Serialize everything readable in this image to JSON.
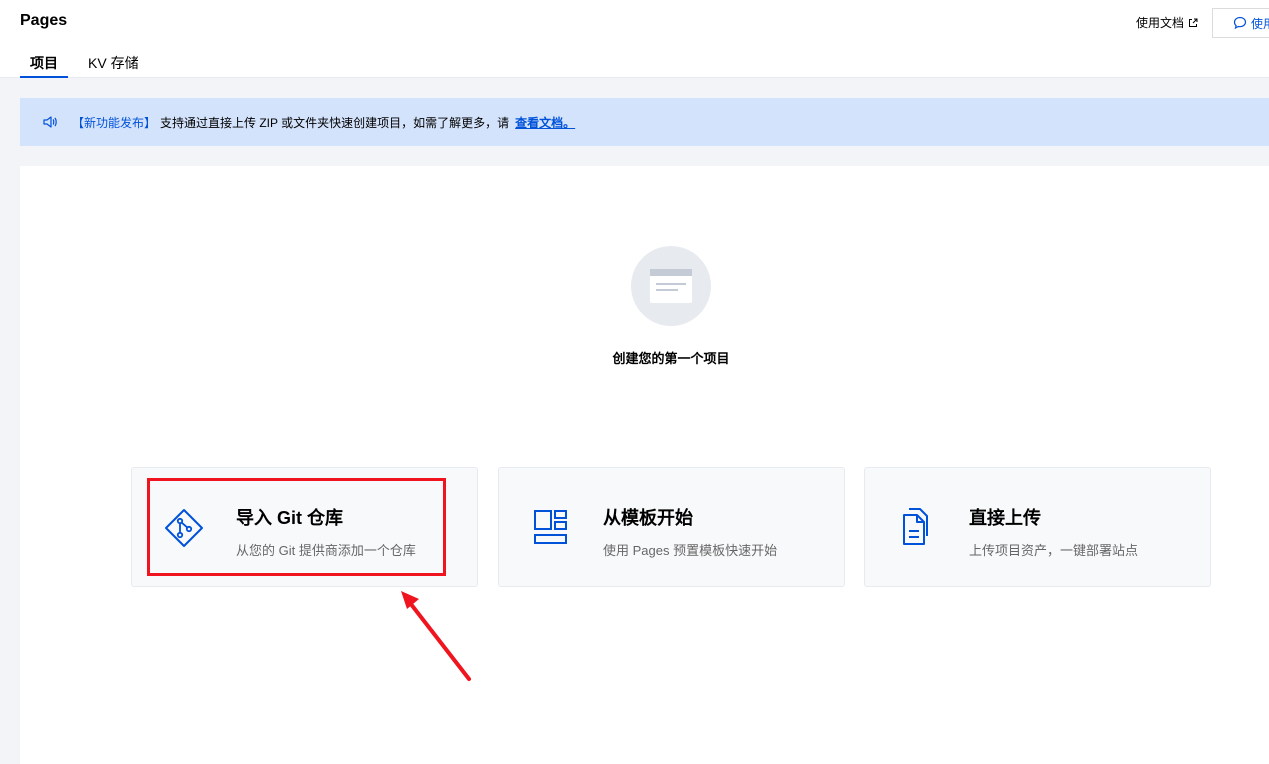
{
  "header": {
    "title": "Pages",
    "tabs": [
      {
        "label": "项目",
        "active": true
      },
      {
        "label": "KV 存储",
        "active": false
      }
    ],
    "doc_link": "使用文档",
    "feedback_button": "使用"
  },
  "notice": {
    "tag": "【新功能发布】",
    "text": "支持通过直接上传 ZIP 或文件夹快速创建项目，如需了解更多，请",
    "link": "查看文档。"
  },
  "empty_state": {
    "title": "创建您的第一个项目"
  },
  "cards": [
    {
      "title": "导入 Git 仓库",
      "description": "从您的 Git 提供商添加一个仓库",
      "icon": "git-branch-icon"
    },
    {
      "title": "从模板开始",
      "description": "使用 Pages 预置模板快速开始",
      "icon": "template-icon"
    },
    {
      "title": "直接上传",
      "description": "上传项目资产，一键部署站点",
      "icon": "upload-files-icon"
    }
  ],
  "colors": {
    "brand": "#0052d9",
    "notice_bg": "#d4e3fc",
    "highlight": "#f0141e"
  }
}
